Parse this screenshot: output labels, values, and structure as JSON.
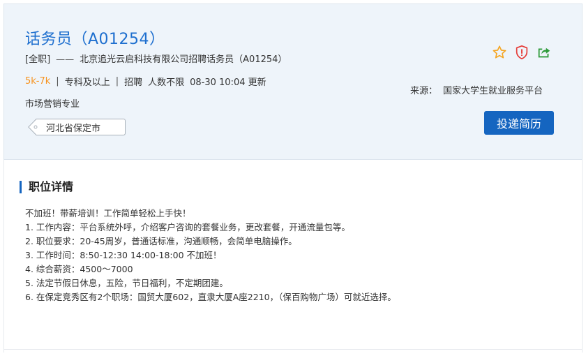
{
  "job": {
    "title": "话务员（A01254）",
    "type": "[全职]",
    "dash": "——",
    "company_line": "北京追光云启科技有限公司招聘话务员（A01254）",
    "salary": "5k-7k",
    "separator": "|",
    "education": "专科及以上",
    "recruit": "招聘",
    "headcount": "人数不限",
    "updated": "08-30 10:04 更新",
    "major": "市场营销专业",
    "location": "河北省保定市"
  },
  "source": {
    "label": "来源：",
    "value": "国家大学生就业服务平台"
  },
  "actions": {
    "apply_label": "投递简历",
    "icons": [
      "star-icon",
      "shield-icon",
      "share-icon"
    ]
  },
  "colors": {
    "accent": "#1565c0",
    "title": "#1e6fcf",
    "salary": "#f7931e",
    "star": "#f5a623",
    "shield": "#e53935",
    "share": "#2e9b3a",
    "header_bg": "#eef4fa"
  },
  "details": {
    "title": "职位详情",
    "lines": [
      "不加班！带薪培训！工作简单轻松上手快！",
      "1. 工作内容：平台系统外呼，介绍客户咨询的套餐业务，更改套餐，开通流量包等。",
      "2. 职位要求：20-45周岁，普通话标准，沟通顺畅，会简单电脑操作。",
      "3. 工作时间：8:50-12:30   14:00-18:00 不加班！",
      "4.  综合薪资：4500～7000",
      "5.  法定节假日休息，五险，节日福利，不定期团建。",
      "6. 在保定竞秀区有2个职场：国贸大厦602，直隶大厦A座2210，（保百购物广场）可就近选择。"
    ]
  }
}
